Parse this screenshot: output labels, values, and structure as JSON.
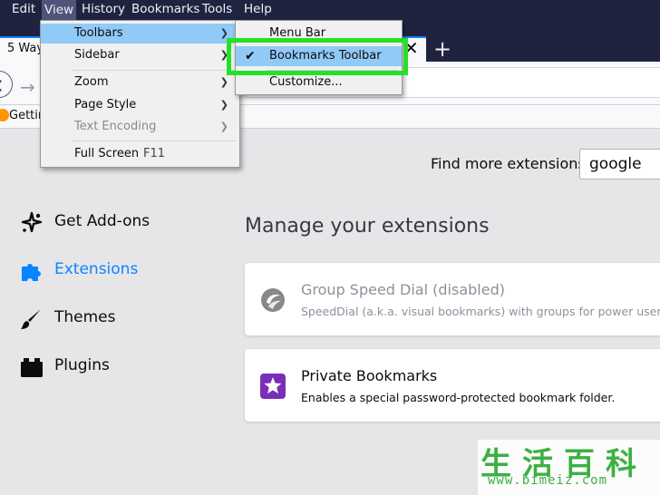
{
  "menubar": {
    "items": [
      "Edit",
      "View",
      "History",
      "Bookmarks",
      "Tools",
      "Help"
    ]
  },
  "tab": {
    "title": "5 Way",
    "close": "✕",
    "new_tab": "+"
  },
  "bookmarks_bar": {
    "item": "Gettin"
  },
  "view_menu": {
    "items": [
      {
        "label": "Toolbars",
        "submenu": true
      },
      {
        "label": "Sidebar",
        "submenu": true
      },
      {
        "label": "Zoom",
        "submenu": true
      },
      {
        "label": "Page Style",
        "submenu": true
      },
      {
        "label": "Text Encoding",
        "submenu": true,
        "disabled": true
      },
      {
        "label": "Full Screen",
        "shortcut": "F11"
      }
    ]
  },
  "toolbars_submenu": {
    "items": [
      {
        "label": "Menu Bar"
      },
      {
        "label": "Bookmarks Toolbar",
        "checked": true
      },
      {
        "label": "Customize..."
      }
    ]
  },
  "find": {
    "label": "Find more extensions",
    "value": "google"
  },
  "categories": [
    {
      "label": "Get Add-ons",
      "icon": "puzzle-sparkle-icon"
    },
    {
      "label": "Extensions",
      "icon": "puzzle-piece-icon",
      "selected": true
    },
    {
      "label": "Themes",
      "icon": "paintbrush-icon"
    },
    {
      "label": "Plugins",
      "icon": "plugin-block-icon"
    }
  ],
  "main": {
    "title": "Manage your extensions",
    "extensions": [
      {
        "name": "Group Speed Dial (disabled)",
        "description": "SpeedDial (a.k.a. visual bookmarks) with groups for power users. Clo",
        "disabled": true
      },
      {
        "name": "Private Bookmarks",
        "description": "Enables a special password-protected bookmark folder."
      }
    ]
  },
  "watermark": {
    "chars": "生活百科",
    "url": "www.bimeiz.com"
  },
  "colors": {
    "accent": "#0a84ff",
    "highlight": "#25e125",
    "chrome": "#202340"
  }
}
